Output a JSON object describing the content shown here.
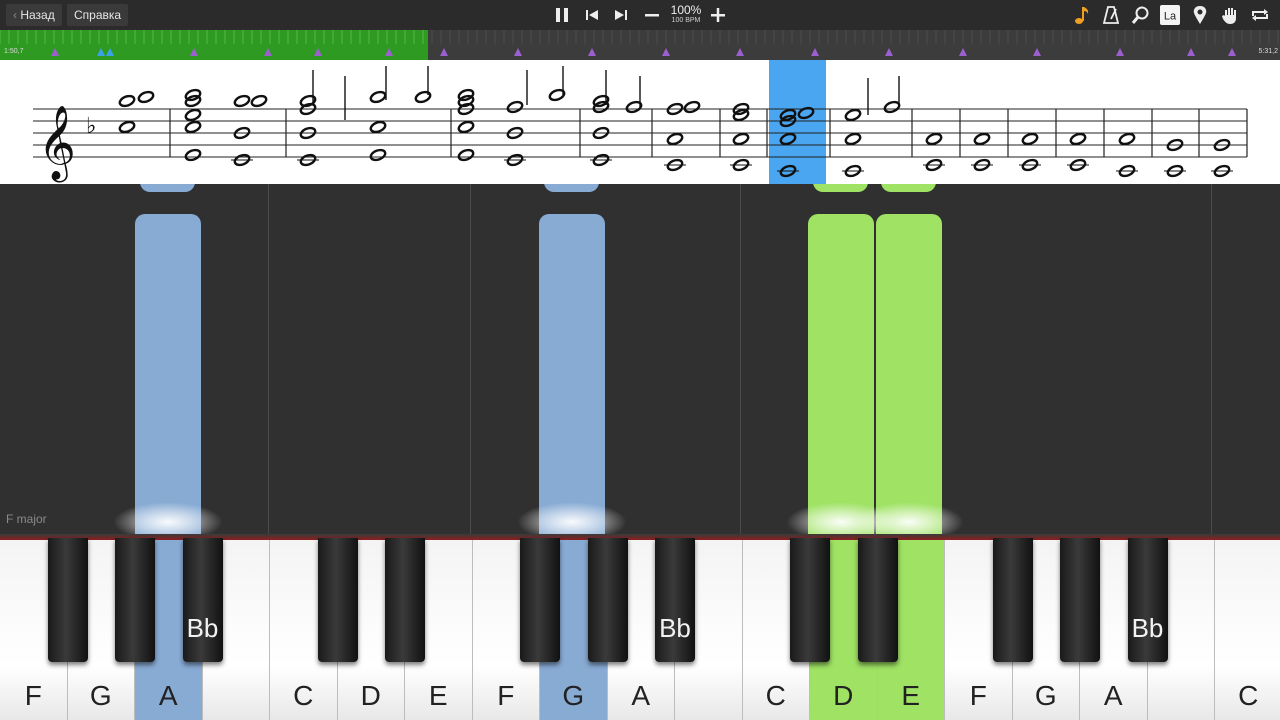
{
  "toolbar": {
    "back_label": "Назад",
    "help_label": "Справка",
    "tempo_percent": "100%",
    "tempo_bpm": "100 BPM"
  },
  "progress": {
    "time_left": "1:50,7",
    "time_right": "5:31,2",
    "played_fraction": 0.334,
    "colors": {
      "played": "#2f9a21",
      "track": "#3c3c3c",
      "marker": "#9b5fd0",
      "marker_played": "#3aa3e8"
    }
  },
  "falling": {
    "key_signature": "F major",
    "colors": {
      "left_hand": "#88abd4",
      "right_hand": "#9fe264"
    }
  },
  "keyboard": {
    "white_keys": [
      "F",
      "G",
      "A",
      "",
      "C",
      "D",
      "E",
      "F",
      "G",
      "A",
      "",
      "C",
      "D",
      "E",
      "F",
      "G",
      "A",
      "",
      "C"
    ],
    "black_labels": [
      "Bb",
      "Bb",
      "Bb"
    ],
    "active_white": {
      "A-1": "#88abd4",
      "G-2": "#88abd4",
      "D-2": "#9fe264",
      "E-2": "#9fe264"
    }
  },
  "icons": [
    "pause-icon",
    "skip-back-icon",
    "skip-forward-icon",
    "minus-icon",
    "plus-icon",
    "note-icon",
    "metronome-icon",
    "magnifier-icon",
    "la-icon",
    "pin-icon",
    "hand-icon",
    "loop-icon"
  ],
  "la_badge": "La"
}
